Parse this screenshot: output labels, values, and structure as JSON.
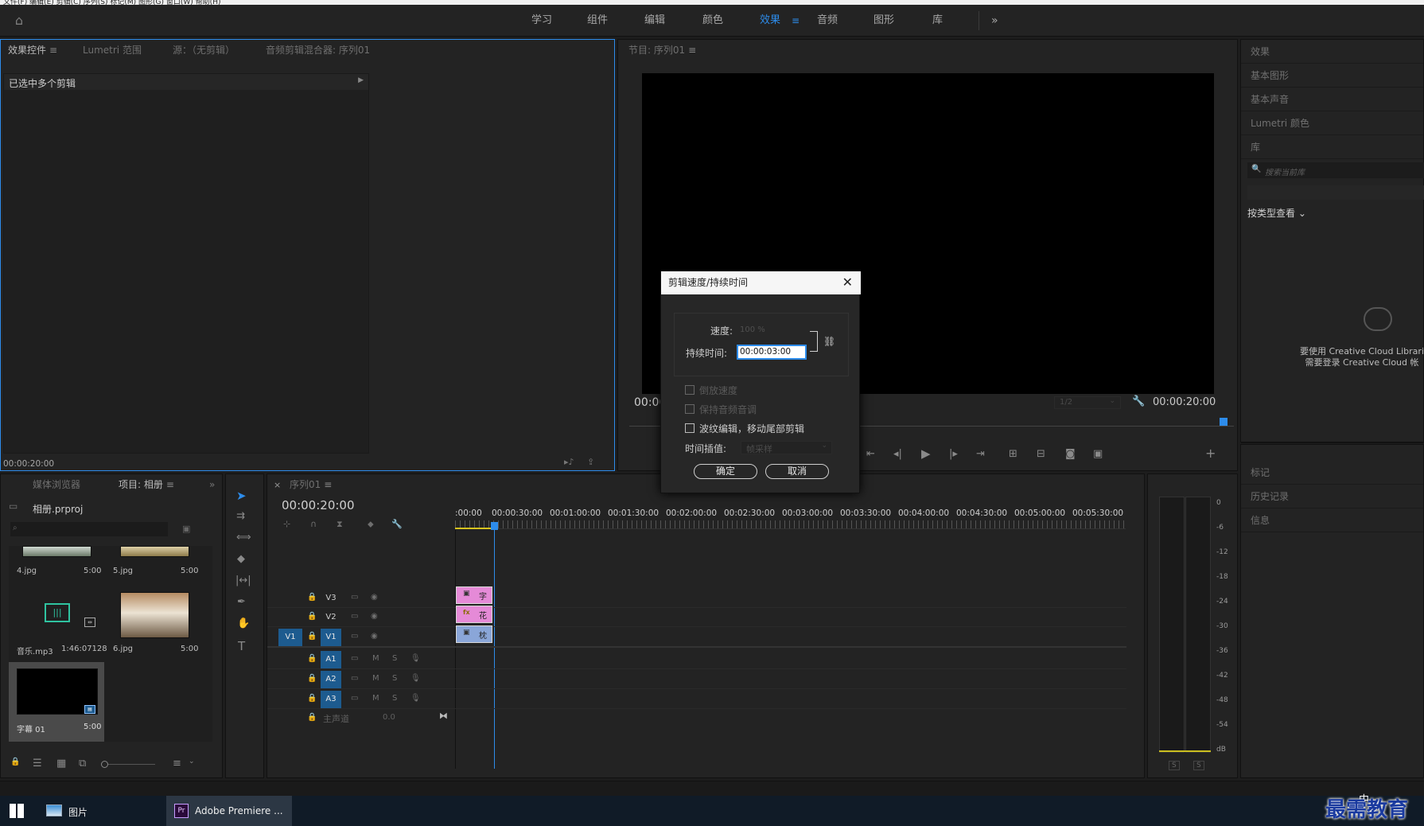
{
  "menubar": {
    "text": "文件(F)  编辑(E)  剪辑(C)  序列(S)  标记(M)  图形(G)  窗口(W)  帮助(H)"
  },
  "workspace": {
    "tabs": [
      "学习",
      "组件",
      "编辑",
      "颜色",
      "效果",
      "音频",
      "图形",
      "库"
    ],
    "active": "效果",
    "more": "»"
  },
  "source_panel": {
    "tabs": [
      "效果控件",
      "Lumetri 范围",
      "源：（无剪辑）",
      "音频剪辑混合器: 序列01"
    ],
    "selected_text": "已选中多个剪辑",
    "timecode": "00:00:20:00"
  },
  "program_panel": {
    "title": "节目: 序列01",
    "timecode_left": "00:00",
    "timecode_right": "00:00:20:00",
    "zoom": "1/2"
  },
  "right_panel": {
    "items": [
      "效果",
      "基本图形",
      "基本声音",
      "Lumetri 颜色",
      "库"
    ],
    "search_placeholder": "搜索当前库",
    "view_by": "按类型查看",
    "cc_message_1": "要使用 Creative Cloud Librari",
    "cc_message_2": "需要登录 Creative Cloud 帐",
    "lower_items": [
      "标记",
      "历史记录",
      "信息"
    ]
  },
  "project_panel": {
    "tabs": [
      "媒体浏览器",
      "项目: 相册"
    ],
    "project_name": "相册.prproj",
    "items": [
      {
        "name": "4.jpg",
        "duration": "5:00"
      },
      {
        "name": "5.jpg",
        "duration": "5:00"
      },
      {
        "name": "音乐.mp3",
        "duration": "1:46:07128"
      },
      {
        "name": "6.jpg",
        "duration": "5:00"
      },
      {
        "name": "字幕 01",
        "duration": "5:00"
      }
    ]
  },
  "timeline": {
    "title": "序列01",
    "timecode": "00:00:20:00",
    "ruler": [
      ":00:00",
      "00:00:30:00",
      "00:01:00:00",
      "00:01:30:00",
      "00:02:00:00",
      "00:02:30:00",
      "00:03:00:00",
      "00:03:30:00",
      "00:04:00:00",
      "00:04:30:00",
      "00:05:00:00",
      "00:05:30:00"
    ],
    "video_tracks": [
      "V3",
      "V2",
      "V1"
    ],
    "audio_tracks": [
      "A1",
      "A2",
      "A3"
    ],
    "source_patch": "V1",
    "master": "主声道",
    "master_value": "0.0",
    "clips": [
      {
        "label": "字"
      },
      {
        "label": "花"
      },
      {
        "label": "枕"
      }
    ],
    "track_m": "M",
    "track_s": "S"
  },
  "audio_meter": {
    "ticks": [
      "0",
      "-6",
      "-12",
      "-18",
      "-24",
      "-30",
      "-36",
      "-42",
      "-48",
      "-54",
      "dB"
    ],
    "solo_left": "S",
    "solo_right": "S"
  },
  "dialog": {
    "title": "剪辑速度/持续时间",
    "speed_label": "速度:",
    "speed_value": "100 %",
    "duration_label": "持续时间:",
    "duration_value": "00:00:03:00",
    "options": [
      {
        "label": "倒放速度",
        "checked": false,
        "enabled": false
      },
      {
        "label": "保持音频音调",
        "checked": false,
        "enabled": false
      },
      {
        "label": "波纹编辑，移动尾部剪辑",
        "checked": false,
        "enabled": true
      }
    ],
    "interp_label": "时间插值:",
    "interp_value": "帧采样",
    "ok": "确定",
    "cancel": "取消"
  },
  "taskbar": {
    "items": [
      "图片",
      "Adobe Premiere ..."
    ],
    "watermark": "最需教育",
    "ime": "中"
  }
}
